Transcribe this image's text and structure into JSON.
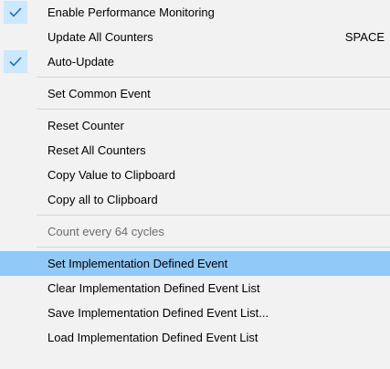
{
  "menu": {
    "items": [
      {
        "label": "Enable Performance Monitoring",
        "checked": true
      },
      {
        "label": "Update All Counters",
        "shortcut": "SPACE"
      },
      {
        "label": "Auto-Update",
        "checked": true
      },
      {
        "label": "Set Common Event"
      },
      {
        "label": "Reset Counter"
      },
      {
        "label": "Reset All Counters"
      },
      {
        "label": "Copy Value to Clipboard"
      },
      {
        "label": "Copy all to Clipboard"
      },
      {
        "label": "Count every 64 cycles",
        "disabled": true
      },
      {
        "label": "Set Implementation Defined Event",
        "highlighted": true
      },
      {
        "label": "Clear Implementation Defined Event List"
      },
      {
        "label": "Save Implementation Defined Event List..."
      },
      {
        "label": "Load Implementation Defined Event List"
      }
    ]
  },
  "colors": {
    "menu_background": "#f2f2f2",
    "check_background": "#cce8ff",
    "highlight": "#91c9f7",
    "separator": "#d7d7d7",
    "disabled_text": "#6d6d6d",
    "check_icon": "#1a6ec2"
  },
  "icons": {
    "check": "checkmark-icon"
  }
}
